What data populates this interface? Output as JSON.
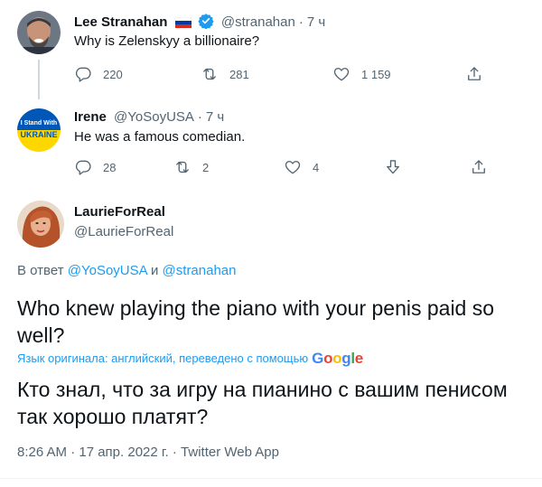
{
  "tweet1": {
    "name": "Lee Stranahan",
    "handle": "@stranahan",
    "time": "7 ч",
    "text": "Why is Zelenskyy a billionaire?",
    "replies": "220",
    "retweets": "281",
    "likes": "1 159"
  },
  "tweet2": {
    "name": "Irene",
    "handle": "@YoSoyUSA",
    "time": "7 ч",
    "avatar_text_top": "I Stand With",
    "avatar_text_bottom": "UKRAINE",
    "text": "He was a famous comedian.",
    "replies": "28",
    "retweets": "2",
    "likes": "4"
  },
  "main": {
    "name": "LaurieForReal",
    "handle": "@LaurieForReal",
    "reply_prefix": "В ответ",
    "reply_user1": "@YoSoyUSA",
    "reply_and": "и",
    "reply_user2": "@stranahan",
    "text_line1": "Who knew playing the piano with your penis paid so",
    "text_line2": "well?",
    "translation_label": "Язык оригинала: английский, переведено с помощью",
    "google": "Google",
    "translated_line1": "Кто знал, что за игру на пианино с вашим пенисом",
    "translated_line2": "так хорошо платят?",
    "timestamp": "8:26 AM · 17 апр. 2022 г. · Twitter Web App"
  },
  "colors": {
    "accent": "#1d9bf0",
    "text": "#0f1419",
    "secondary": "#536471",
    "ukraine_blue": "#0057b7",
    "ukraine_yellow": "#ffd700"
  }
}
